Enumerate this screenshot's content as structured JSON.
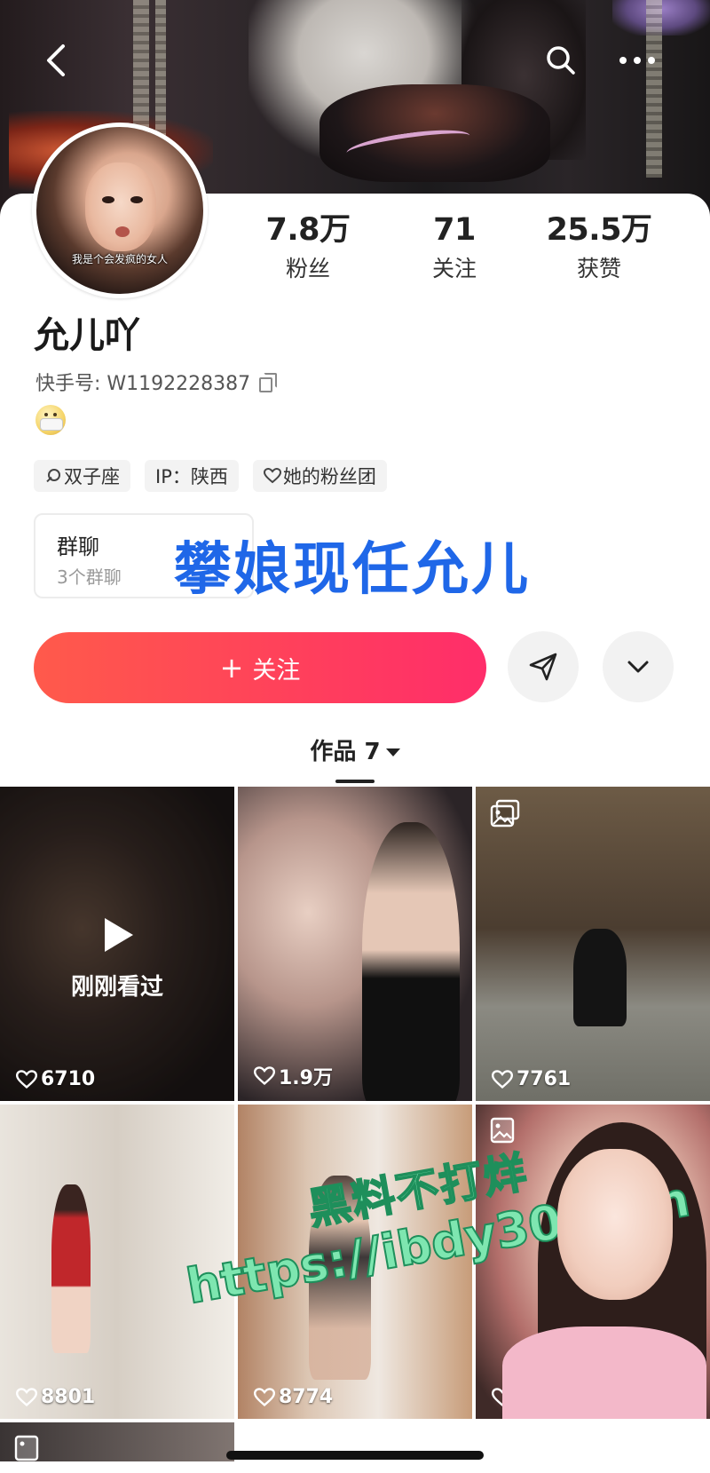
{
  "header": {
    "back_icon": "chevron-left-icon",
    "search_icon": "search-icon",
    "more_icon": "ellipsis-icon"
  },
  "profile": {
    "avatar_caption": "我是个会发疯的女人",
    "stats": [
      {
        "value": "7.8万",
        "label": "粉丝"
      },
      {
        "value": "71",
        "label": "关注"
      },
      {
        "value": "25.5万",
        "label": "获赞"
      }
    ],
    "name": "允儿吖",
    "uid_label": "快手号: W1192228387",
    "tags": [
      {
        "label": "双子座",
        "icon": "search-icon"
      },
      {
        "label": "IP：陕西",
        "icon": ""
      },
      {
        "label": "她的粉丝团",
        "icon": "heart-icon"
      }
    ],
    "group_chat": {
      "title": "群聊",
      "subtitle": "3个群聊"
    },
    "overlay_text": "攀娘现任允儿"
  },
  "actions": {
    "follow_label": "关注",
    "follow_plus": "+",
    "send_icon": "paper-plane-icon",
    "expand_icon": "chevron-down-icon"
  },
  "works_tab": {
    "label": "作品 7"
  },
  "grid": {
    "tiles": [
      {
        "likes": "6710",
        "overlay": "刚刚看过"
      },
      {
        "likes": "1.9万"
      },
      {
        "likes": "7761"
      },
      {
        "likes": "8801"
      },
      {
        "likes": "8774"
      },
      {
        "likes": "636"
      }
    ]
  },
  "watermark": {
    "line1": "黑料不打烊",
    "line2": "https://ibdy30.com"
  },
  "colors": {
    "follow_gradient_start": "#ff5a4b",
    "follow_gradient_end": "#ff2d6a",
    "overlay_text": "#1f67e8",
    "watermark": "#7ee6b0"
  }
}
